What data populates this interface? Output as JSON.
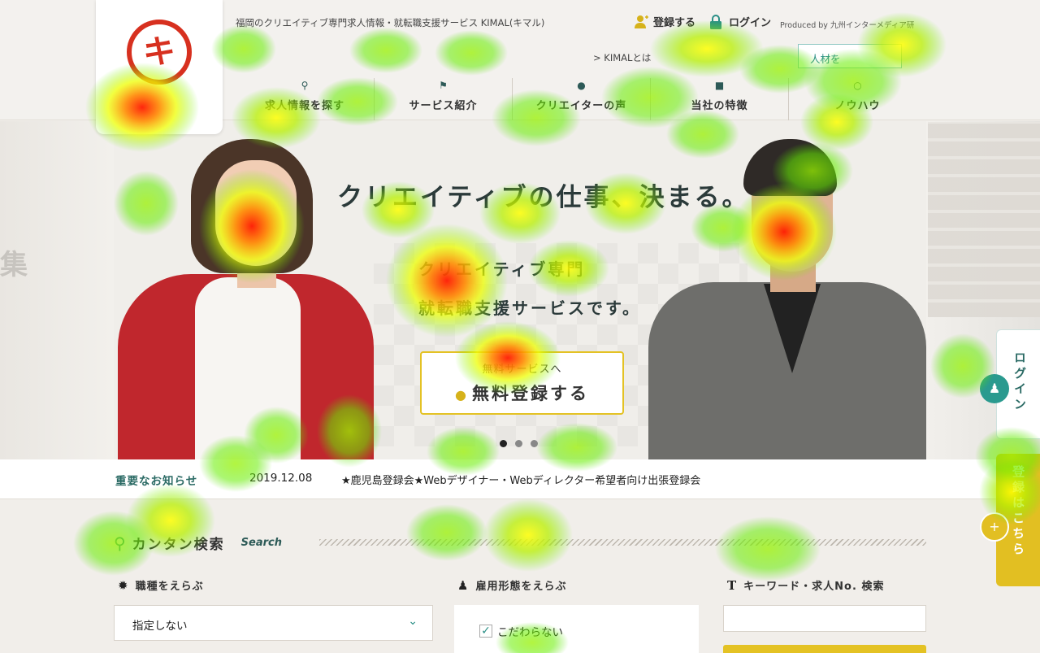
{
  "header": {
    "logo_char": "キ",
    "tagline": "福岡のクリエイティブ専門求人情報・就転職支援サービス KIMAL(キマル)",
    "register_label": "登録する",
    "login_label": "ログイン",
    "produced_by": "Produced by 九州インターメディア研",
    "kimal_about": "> KIMALとは",
    "recruit_button": "人材を",
    "nav": [
      {
        "label": "求人情報を探す",
        "icon": "search-icon"
      },
      {
        "label": "サービス紹介",
        "icon": "flag-icon"
      },
      {
        "label": "クリエイターの声",
        "icon": "speech-bubble-icon"
      },
      {
        "label": "当社の特徴",
        "icon": "book-icon"
      },
      {
        "label": "ノウハウ",
        "icon": "lightbulb-icon"
      }
    ]
  },
  "hero": {
    "side_text": "集",
    "headline": "クリエイティブの仕事、決まる。",
    "sub1": "クリエイティブ専門",
    "sub2": "就転職支援サービスです。",
    "cta_top": "無料サービスへ",
    "cta_main": "無料登録する",
    "slide_count": 3,
    "active_slide": 1
  },
  "news": {
    "label": "重要なお知らせ",
    "date": "2019.12.08",
    "title": "★鹿児島登録会★Webデザイナー・Webディレクター希望者向け出張登録会"
  },
  "search": {
    "title": "カンタン検索",
    "title_en": "Search",
    "job_label": "職種をえらぶ",
    "job_value": "指定しない",
    "employment_label": "雇用形態をえらぶ",
    "employment_option": "こだわらない",
    "employment_checked": true,
    "keyword_label": "キーワード・求人No. 検索",
    "keyword_placeholder": ""
  },
  "side": {
    "login": "ログイン",
    "register": "登録はこちら"
  },
  "colors": {
    "accent_teal": "#2a8f86",
    "accent_yellow": "#e4c224",
    "logo_red": "#d7301f",
    "cardigan_red": "#c0272d"
  }
}
